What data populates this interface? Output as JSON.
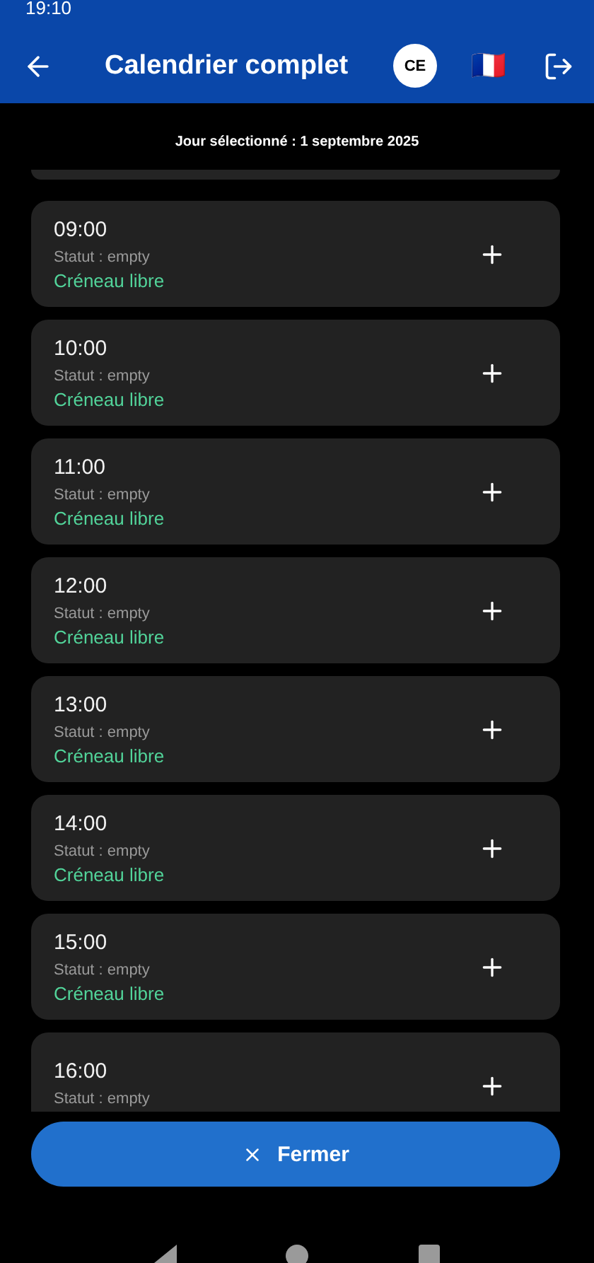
{
  "status_bar": {
    "time": "19:10"
  },
  "app_bar": {
    "title": "Calendrier complet",
    "avatar": "CE",
    "flag": "🇫🇷"
  },
  "selected_day": "Jour sélectionné : 1 septembre 2025",
  "slots": [
    {
      "time": "09:00",
      "status": "Statut : empty",
      "label": "Créneau libre"
    },
    {
      "time": "10:00",
      "status": "Statut : empty",
      "label": "Créneau libre"
    },
    {
      "time": "11:00",
      "status": "Statut : empty",
      "label": "Créneau libre"
    },
    {
      "time": "12:00",
      "status": "Statut : empty",
      "label": "Créneau libre"
    },
    {
      "time": "13:00",
      "status": "Statut : empty",
      "label": "Créneau libre"
    },
    {
      "time": "14:00",
      "status": "Statut : empty",
      "label": "Créneau libre"
    },
    {
      "time": "15:00",
      "status": "Statut : empty",
      "label": "Créneau libre"
    },
    {
      "time": "16:00",
      "status": "Statut : empty"
    }
  ],
  "close_button": "Fermer"
}
